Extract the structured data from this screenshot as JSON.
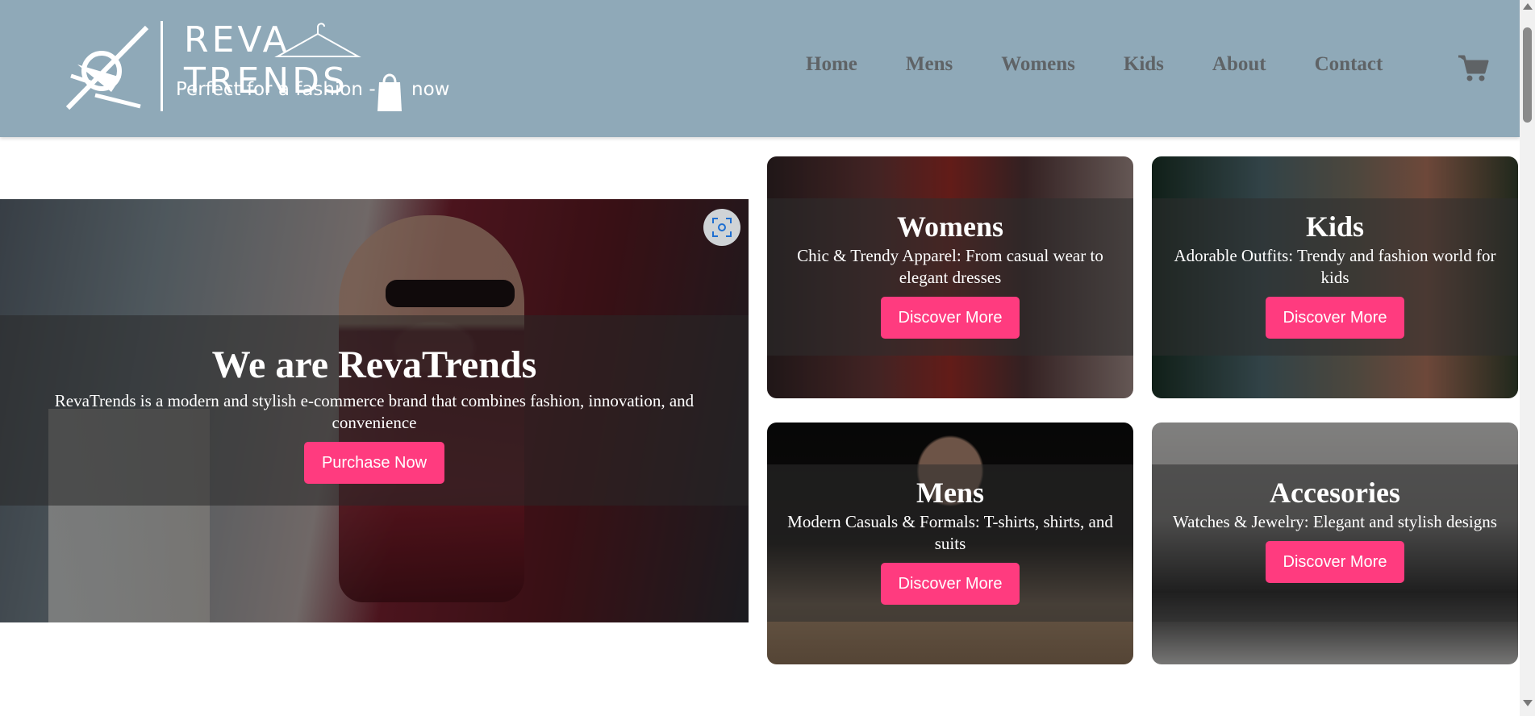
{
  "header": {
    "logo": {
      "title": "REVA TRENDS",
      "tagline_before": "Perfect for a fashion -",
      "tagline_after": "now"
    },
    "nav": [
      "Home",
      "Mens",
      "Womens",
      "Kids",
      "About",
      "Contact"
    ],
    "cart_icon": "cart-icon",
    "background_color": "#8fa9b8"
  },
  "hero": {
    "title": "We are RevaTrends",
    "text": "RevaTrends is a modern and stylish e-commerce brand that combines fashion, innovation, and convenience",
    "button": "Purchase Now",
    "scan_icon": "visual-search-icon"
  },
  "cards": [
    {
      "title": "Womens",
      "text": "Chic & Trendy Apparel: From casual wear to elegant dresses",
      "button": "Discover More"
    },
    {
      "title": "Kids",
      "text": "Adorable Outfits: Trendy and fashion world for kids",
      "button": "Discover More"
    },
    {
      "title": "Mens",
      "text": "Modern Casuals & Formals: T-shirts, shirts, and suits",
      "button": "Discover More"
    },
    {
      "title": "Accesories",
      "text": "Watches & Jewelry: Elegant and stylish designs",
      "button": "Discover More"
    }
  ],
  "colors": {
    "accent": "#ff3b7f",
    "nav_text": "#5f6366"
  }
}
